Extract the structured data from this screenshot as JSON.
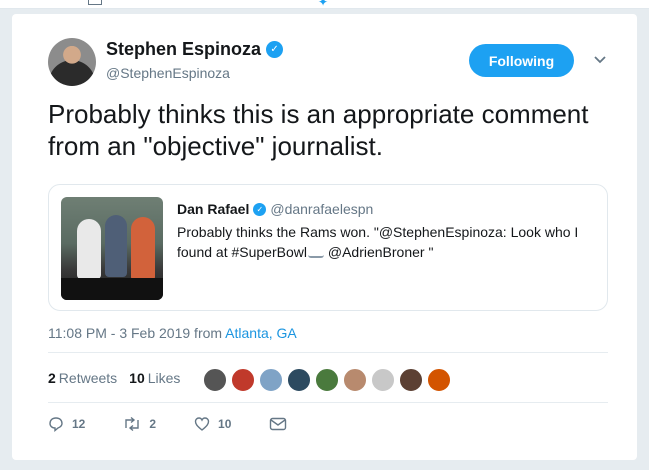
{
  "tweet": {
    "author_name": "Stephen Espinoza",
    "author_handle": "@StephenEspinoza",
    "follow_label": "Following",
    "text": "Probably thinks this is an appropriate comment from an \"objective\" journalist.",
    "quoted": {
      "name": "Dan Rafael",
      "handle": "@danrafaelespn",
      "text_main": "Probably thinks the Rams won. \"@StephenEspinoza: Look who I found at #SuperBowl",
      "text_tail": " @AdrienBroner \""
    },
    "time": "11:08 PM - 3 Feb 2019 from ",
    "location": "Atlanta, GA",
    "retweets_count": "2",
    "retweets_label": "Retweets",
    "likes_count": "10",
    "likes_label": "Likes",
    "actions": {
      "reply_count": "12",
      "retweet_count": "2",
      "like_count": "10"
    }
  },
  "liker_avatar_colors": [
    "#555555",
    "#c0392b",
    "#7fa3c6",
    "#2c4a60",
    "#4a7a3d",
    "#b88a6e",
    "#c8c8c8",
    "#5c4033",
    "#d35400"
  ],
  "colors": {
    "accent": "#1da1f2",
    "text_secondary": "#657786"
  }
}
